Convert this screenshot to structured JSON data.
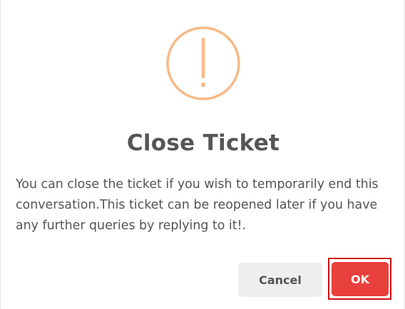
{
  "dialog": {
    "icon": "exclamation-circle-icon",
    "title": "Close Ticket",
    "message": "You can close the ticket if you wish to temporarily end this conversation.This ticket can be reopened later if you have any further queries by replying to it!.",
    "cancel_label": "Cancel",
    "ok_label": "OK"
  },
  "colors": {
    "icon": "#f7b987",
    "ok_button": "#e8403c",
    "highlight": "#cc1111",
    "cancel_button": "#eeeeee"
  }
}
